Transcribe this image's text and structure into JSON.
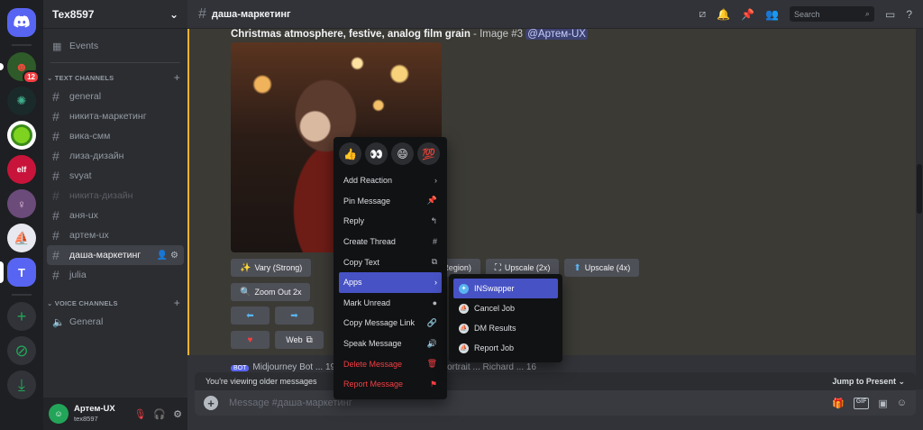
{
  "servers": [
    {
      "name": "server-1",
      "badge": "12"
    },
    {
      "name": "server-2"
    },
    {
      "name": "server-3"
    },
    {
      "name": "server-4"
    },
    {
      "name": "server-5"
    },
    {
      "name": "server-6"
    },
    {
      "letter": "T"
    }
  ],
  "sidebar": {
    "guild_name": "Tex8597",
    "events_label": "Events",
    "text_category": "TEXT CHANNELS",
    "voice_category": "VOICE CHANNELS",
    "text_channels": [
      "general",
      "никита-маркетинг",
      "вика-смм",
      "лиза-дизайн",
      "svyat",
      "никита-дизайн",
      "аня-ux",
      "артем-ux",
      "даша-маркетинг",
      "julia"
    ],
    "voice_channels": [
      "General"
    ]
  },
  "user": {
    "display_name": "Артем-UX",
    "tag": "tex8597"
  },
  "header": {
    "channel": "даша-маркетинг",
    "search_placeholder": "Search"
  },
  "message": {
    "prompt_text": "Christmas atmosphere, festive, analog film grain",
    "meta": " - Image #3 ",
    "mention": "@Артем-UX"
  },
  "buttons": {
    "vary_strong": "Vary (Strong)",
    "vary_region": "Region)",
    "upscale_2x": "Upscale (2x)",
    "upscale_4x": "Upscale (4x)",
    "zoom_out": "Zoom Out 2x",
    "web": "Web"
  },
  "next_message": "Midjourney Bot  ... 1950s vintage  ... soft lighting portrait ... Richard ... 16",
  "older_bar": {
    "text": "You're viewing older messages",
    "jump": "Jump to Present"
  },
  "composer": {
    "placeholder": "Message #даша-маркетинг"
  },
  "context_menu": {
    "reactions": [
      "👍",
      "👀",
      "😄",
      "💯"
    ],
    "items": [
      {
        "label": "Add Reaction",
        "icon": "›"
      },
      {
        "label": "Pin Message",
        "icon": "📌"
      },
      {
        "label": "Reply",
        "icon": "↰"
      },
      {
        "label": "Create Thread",
        "icon": "#"
      },
      {
        "label": "Copy Text",
        "icon": "⧉"
      },
      {
        "label": "Apps",
        "icon": "›"
      },
      {
        "label": "Mark Unread",
        "icon": "●"
      },
      {
        "label": "Copy Message Link",
        "icon": "🔗"
      },
      {
        "label": "Speak Message",
        "icon": "🔊"
      },
      {
        "label": "Delete Message",
        "icon": "🗑"
      },
      {
        "label": "Report Message",
        "icon": "⚑"
      }
    ]
  },
  "apps_submenu": [
    "INSwapper",
    "Cancel Job",
    "DM Results",
    "Report Job"
  ]
}
